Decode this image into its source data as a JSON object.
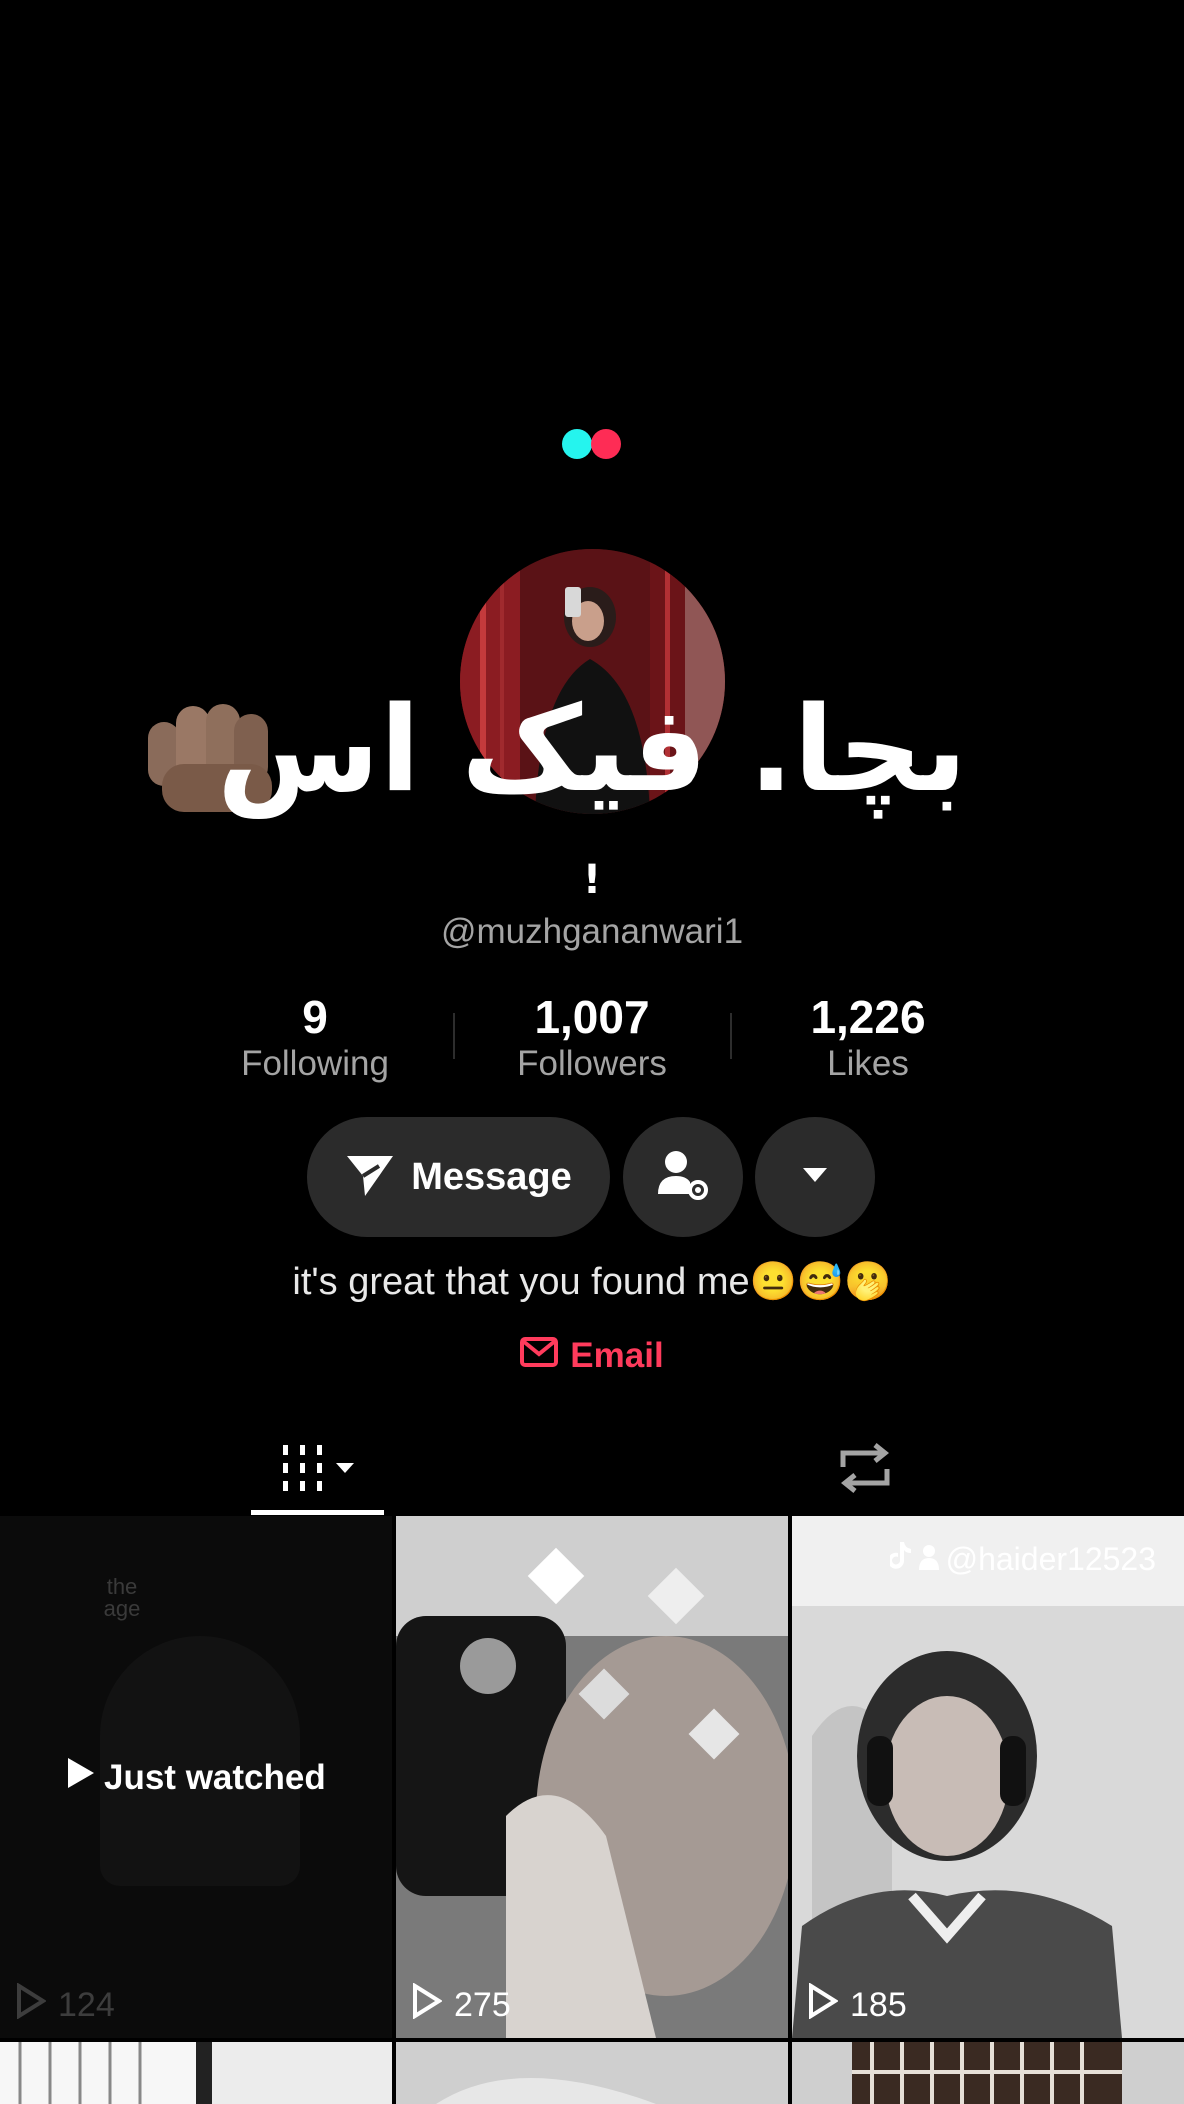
{
  "profile": {
    "display_name": "بچا. فیک اس",
    "display_name_suffix": "!",
    "username": "@muzhgananwari1",
    "bio": "it's great that you found me😐😅🫢",
    "email_label": "Email"
  },
  "stats": [
    {
      "value": "9",
      "label": "Following"
    },
    {
      "value": "1,007",
      "label": "Followers"
    },
    {
      "value": "1,226",
      "label": "Likes"
    }
  ],
  "actions": {
    "message_label": "Message",
    "add_friend_icon": "person-gear-icon",
    "more_icon": "caret-down-icon"
  },
  "tabs": [
    {
      "icon": "grid-icon",
      "active": true
    },
    {
      "icon": "repost-icon",
      "active": false
    }
  ],
  "videos": [
    {
      "overlay_top": "the\nage",
      "badge": "Just watched",
      "views": "124"
    },
    {
      "views": "275"
    },
    {
      "tag": "@haider12523",
      "views": "185"
    }
  ],
  "colors": {
    "accent": "#ff3b5c",
    "dot_cyan": "#25f4ee",
    "dot_red": "#fe2c55",
    "button_bg": "#2b2b2b"
  }
}
